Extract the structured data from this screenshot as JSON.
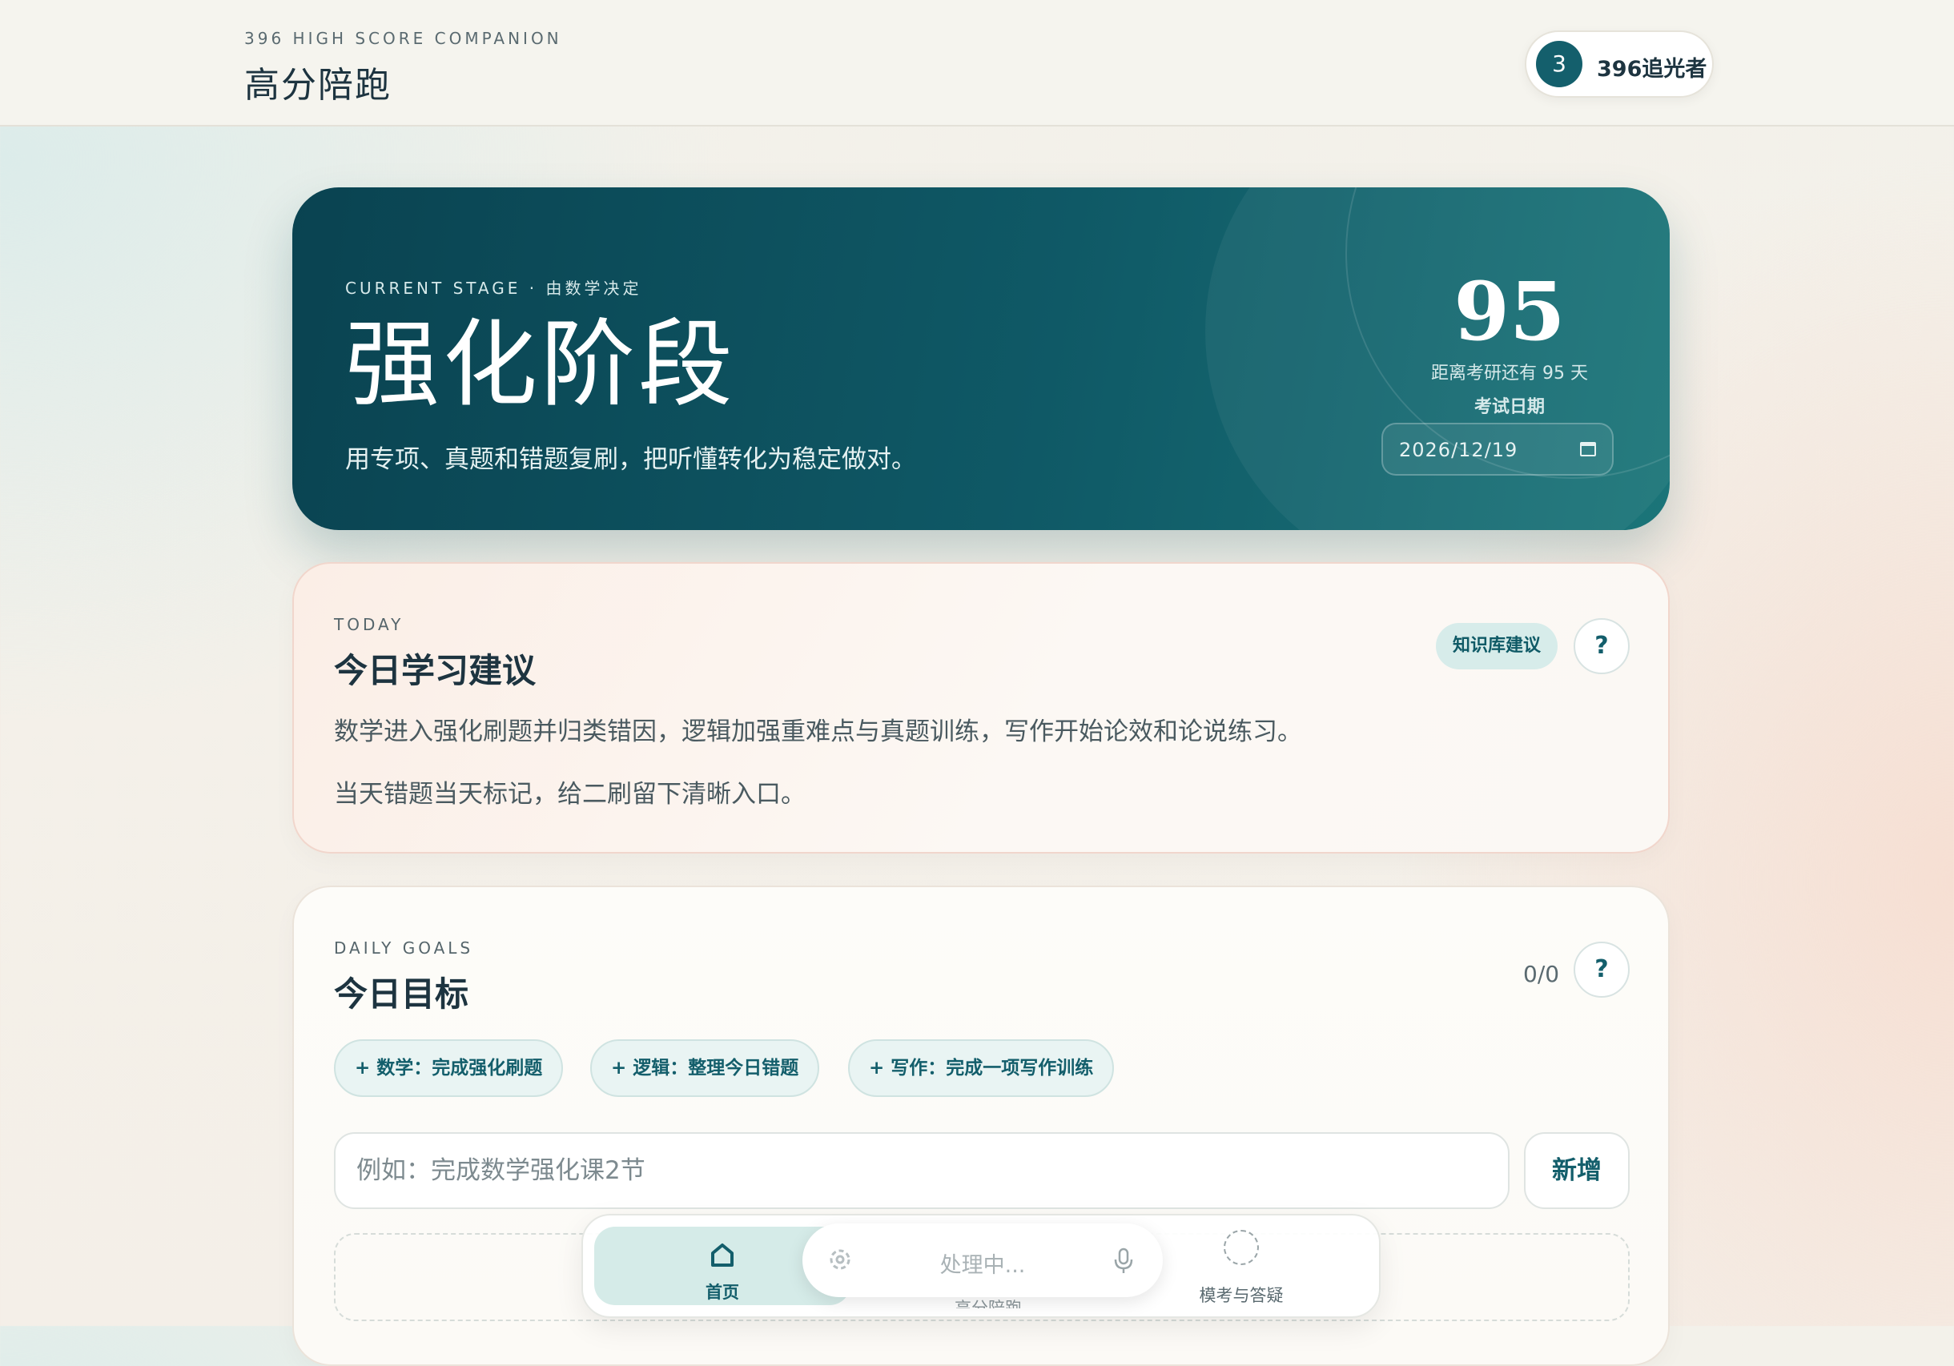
{
  "header": {
    "kicker": "396 HIGH SCORE COMPANION",
    "title": "高分陪跑",
    "user_badge": "3",
    "user_name": "396追光者"
  },
  "hero": {
    "kicker": "CURRENT STAGE · 由数学决定",
    "title": "强化阶段",
    "subtitle": "用专项、真题和错题复刷，把听懂转化为稳定做对。",
    "days_left": "95",
    "days_label": "距离考研还有 95 天",
    "exam_date_label": "考试日期",
    "exam_date_value": "2026/12/19"
  },
  "today": {
    "kicker": "TODAY",
    "title": "今日学习建议",
    "badge": "知识库建议",
    "help": "?",
    "lines": [
      "数学进入强化刷题并归类错因，逻辑加强重难点与真题训练，写作开始论效和论说练习。",
      "当天错题当天标记，给二刷留下清晰入口。"
    ]
  },
  "goals": {
    "kicker": "DAILY GOALS",
    "title": "今日目标",
    "count": "0/0",
    "help": "?",
    "chips": [
      "+ 数学：完成强化刷题",
      "+ 逻辑：整理今日错题",
      "+ 写作：完成一项写作训练"
    ],
    "input_placeholder": "例如：完成数学强化课2节",
    "add_label": "新增"
  },
  "bottom_nav": {
    "home_label": "首页",
    "voice_status": "处理中...",
    "hidden_label": "高分陪跑",
    "exam_label": "模考与答疑"
  },
  "colors": {
    "accent": "#135e6b",
    "hero_start": "#0a4351",
    "hero_end": "#1b7579"
  }
}
